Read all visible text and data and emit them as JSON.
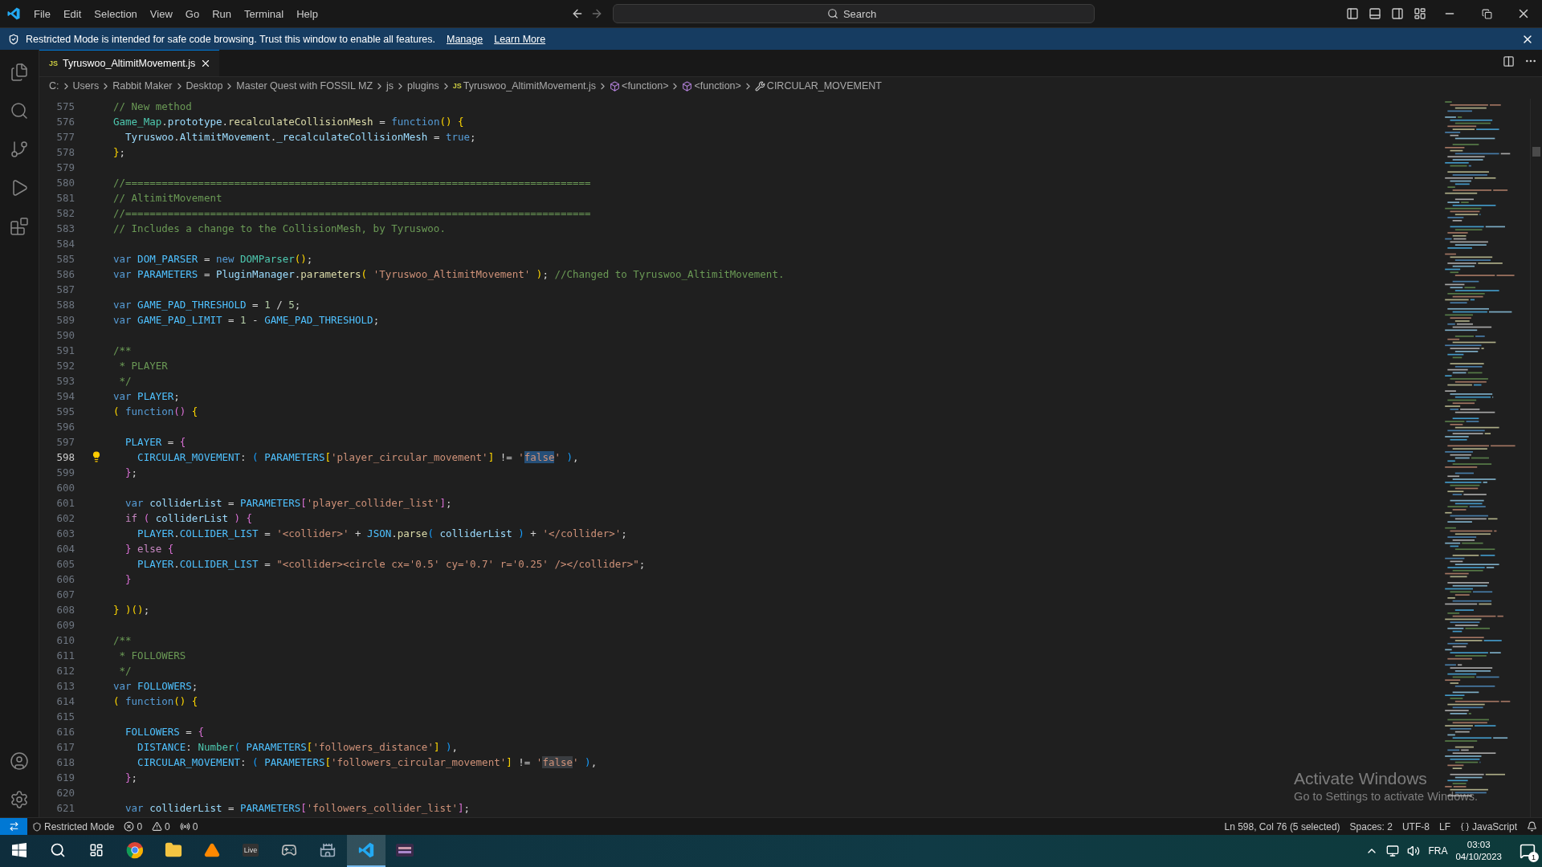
{
  "menu": [
    "File",
    "Edit",
    "Selection",
    "View",
    "Go",
    "Run",
    "Terminal",
    "Help"
  ],
  "search": {
    "placeholder": "Search"
  },
  "banner": {
    "text": "Restricted Mode is intended for safe code browsing. Trust this window to enable all features.",
    "links": [
      "Manage",
      "Learn More"
    ]
  },
  "tabs": [
    {
      "badge": "JS",
      "label": "Tyruswoo_AltimitMovement.js",
      "selected": true
    }
  ],
  "breadcrumb": [
    {
      "kind": "folder",
      "label": "C:"
    },
    {
      "kind": "folder",
      "label": "Users"
    },
    {
      "kind": "folder",
      "label": "Rabbit Maker"
    },
    {
      "kind": "folder",
      "label": "Desktop"
    },
    {
      "kind": "folder",
      "label": "Master Quest with FOSSIL MZ"
    },
    {
      "kind": "folder",
      "label": "js"
    },
    {
      "kind": "folder",
      "label": "plugins"
    },
    {
      "kind": "file",
      "badge": "JS",
      "label": "Tyruswoo_AltimitMovement.js"
    },
    {
      "kind": "function",
      "label": "<function>"
    },
    {
      "kind": "function",
      "label": "<function>"
    },
    {
      "kind": "property",
      "label": "CIRCULAR_MOVEMENT"
    }
  ],
  "lines": [
    {
      "number": "575",
      "current": false,
      "tokens": [
        {
          "kind": "cm",
          "text": "// New method"
        }
      ]
    },
    {
      "number": "576",
      "current": false,
      "tokens": [
        {
          "kind": "ty",
          "text": "Game_Map"
        },
        {
          "kind": "op",
          "text": "."
        },
        {
          "kind": "var",
          "text": "prototype"
        },
        {
          "kind": "op",
          "text": "."
        },
        {
          "kind": "fn",
          "text": "recalculateCollisionMesh"
        },
        {
          "kind": "op",
          "text": " = "
        },
        {
          "kind": "kw",
          "text": "function"
        },
        {
          "kind": "b1",
          "text": "() "
        },
        {
          "kind": "b1",
          "text": "{"
        }
      ]
    },
    {
      "number": "577",
      "current": false,
      "tokens": [
        {
          "kind": "var",
          "text": "  Tyruswoo"
        },
        {
          "kind": "op",
          "text": "."
        },
        {
          "kind": "var",
          "text": "AltimitMovement"
        },
        {
          "kind": "op",
          "text": "."
        },
        {
          "kind": "var",
          "text": "_recalculateCollisionMesh"
        },
        {
          "kind": "op",
          "text": " = "
        },
        {
          "kind": "kw",
          "text": "true"
        },
        {
          "kind": "op",
          "text": ";"
        }
      ]
    },
    {
      "number": "578",
      "current": false,
      "tokens": [
        {
          "kind": "b1",
          "text": "}"
        },
        {
          "kind": "op",
          "text": ";"
        }
      ]
    },
    {
      "number": "579",
      "current": false
    },
    {
      "number": "580",
      "current": false,
      "tokens": [
        {
          "kind": "cm",
          "text": "//============================================================================="
        }
      ]
    },
    {
      "number": "581",
      "current": false,
      "tokens": [
        {
          "kind": "cm",
          "text": "// AltimitMovement"
        }
      ]
    },
    {
      "number": "582",
      "current": false,
      "tokens": [
        {
          "kind": "cm",
          "text": "//============================================================================="
        }
      ]
    },
    {
      "number": "583",
      "current": false,
      "tokens": [
        {
          "kind": "cm",
          "text": "// Includes a change to the CollisionMesh, by Tyruswoo."
        }
      ]
    },
    {
      "number": "584",
      "current": false
    },
    {
      "number": "585",
      "current": false,
      "tokens": [
        {
          "kind": "kw",
          "text": "var "
        },
        {
          "kind": "cst",
          "text": "DOM_PARSER"
        },
        {
          "kind": "op",
          "text": " = "
        },
        {
          "kind": "kw",
          "text": "new "
        },
        {
          "kind": "ty",
          "text": "DOMParser"
        },
        {
          "kind": "b1",
          "text": "()"
        },
        {
          "kind": "op",
          "text": ";"
        }
      ]
    },
    {
      "number": "586",
      "current": false,
      "tokens": [
        {
          "kind": "kw",
          "text": "var "
        },
        {
          "kind": "cst",
          "text": "PARAMETERS"
        },
        {
          "kind": "op",
          "text": " = "
        },
        {
          "kind": "var",
          "text": "PluginManager"
        },
        {
          "kind": "op",
          "text": "."
        },
        {
          "kind": "fn",
          "text": "parameters"
        },
        {
          "kind": "b1",
          "text": "( "
        },
        {
          "kind": "str",
          "text": "'Tyruswoo_AltimitMovement' "
        },
        {
          "kind": "b1",
          "text": ")"
        },
        {
          "kind": "op",
          "text": "; "
        },
        {
          "kind": "cm",
          "text": "//Changed to Tyruswoo_AltimitMovement."
        }
      ]
    },
    {
      "number": "587",
      "current": false
    },
    {
      "number": "588",
      "current": false,
      "tokens": [
        {
          "kind": "kw",
          "text": "var "
        },
        {
          "kind": "cst",
          "text": "GAME_PAD_THRESHOLD"
        },
        {
          "kind": "op",
          "text": " = "
        },
        {
          "kind": "num",
          "text": "1"
        },
        {
          "kind": "op",
          "text": " / "
        },
        {
          "kind": "num",
          "text": "5"
        },
        {
          "kind": "op",
          "text": ";"
        }
      ]
    },
    {
      "number": "589",
      "current": false,
      "tokens": [
        {
          "kind": "kw",
          "text": "var "
        },
        {
          "kind": "cst",
          "text": "GAME_PAD_LIMIT"
        },
        {
          "kind": "op",
          "text": " = "
        },
        {
          "kind": "num",
          "text": "1"
        },
        {
          "kind": "op",
          "text": " - "
        },
        {
          "kind": "cst",
          "text": "GAME_PAD_THRESHOLD"
        },
        {
          "kind": "op",
          "text": ";"
        }
      ]
    },
    {
      "number": "590",
      "current": false
    },
    {
      "number": "591",
      "current": false,
      "tokens": [
        {
          "kind": "cm",
          "text": "/**"
        }
      ]
    },
    {
      "number": "592",
      "current": false,
      "tokens": [
        {
          "kind": "cm",
          "text": " * PLAYER"
        }
      ]
    },
    {
      "number": "593",
      "current": false,
      "tokens": [
        {
          "kind": "cm",
          "text": " */"
        }
      ]
    },
    {
      "number": "594",
      "current": false,
      "tokens": [
        {
          "kind": "kw",
          "text": "var "
        },
        {
          "kind": "cst",
          "text": "PLAYER"
        },
        {
          "kind": "op",
          "text": ";"
        }
      ]
    },
    {
      "number": "595",
      "current": false,
      "tokens": [
        {
          "kind": "b1",
          "text": "( "
        },
        {
          "kind": "kw",
          "text": "function"
        },
        {
          "kind": "b2",
          "text": "() "
        },
        {
          "kind": "b1",
          "text": "{"
        }
      ]
    },
    {
      "number": "596",
      "current": false
    },
    {
      "number": "597",
      "current": false,
      "tokens": [
        {
          "kind": "cst",
          "text": "  PLAYER"
        },
        {
          "kind": "op",
          "text": " = "
        },
        {
          "kind": "b2",
          "text": "{"
        }
      ]
    },
    {
      "number": "598",
      "current": true,
      "tokens": [
        {
          "kind": "cst",
          "text": "    CIRCULAR_MOVEMENT"
        },
        {
          "kind": "op",
          "text": ": "
        },
        {
          "kind": "b3",
          "text": "( "
        },
        {
          "kind": "cst",
          "text": "PARAMETERS"
        },
        {
          "kind": "b1",
          "text": "["
        },
        {
          "kind": "str",
          "text": "'player_circular_movement'"
        },
        {
          "kind": "b1",
          "text": "]"
        },
        {
          "kind": "op",
          "text": " != "
        },
        {
          "kind": "str",
          "text": "'"
        },
        {
          "kind": "sel",
          "text": "false"
        },
        {
          "kind": "str",
          "text": "' "
        },
        {
          "kind": "b3",
          "text": ")"
        },
        {
          "kind": "op",
          "text": ","
        }
      ]
    },
    {
      "number": "599",
      "current": false,
      "tokens": [
        {
          "kind": "b2",
          "text": "  }"
        },
        {
          "kind": "op",
          "text": ";"
        }
      ]
    },
    {
      "number": "600",
      "current": false
    },
    {
      "number": "601",
      "current": false,
      "tokens": [
        {
          "kind": "kw",
          "text": "  var "
        },
        {
          "kind": "var",
          "text": "colliderList"
        },
        {
          "kind": "op",
          "text": " = "
        },
        {
          "kind": "cst",
          "text": "PARAMETERS"
        },
        {
          "kind": "b2",
          "text": "["
        },
        {
          "kind": "str",
          "text": "'player_collider_list'"
        },
        {
          "kind": "b2",
          "text": "]"
        },
        {
          "kind": "op",
          "text": ";"
        }
      ]
    },
    {
      "number": "602",
      "current": false,
      "tokens": [
        {
          "kind": "ctl",
          "text": "  if "
        },
        {
          "kind": "b2",
          "text": "( "
        },
        {
          "kind": "var",
          "text": "colliderList "
        },
        {
          "kind": "b2",
          "text": ") {"
        }
      ]
    },
    {
      "number": "603",
      "current": false,
      "tokens": [
        {
          "kind": "cst",
          "text": "    PLAYER"
        },
        {
          "kind": "op",
          "text": "."
        },
        {
          "kind": "cst",
          "text": "COLLIDER_LIST"
        },
        {
          "kind": "op",
          "text": " = "
        },
        {
          "kind": "str",
          "text": "'<collider>'"
        },
        {
          "kind": "op",
          "text": " + "
        },
        {
          "kind": "cst",
          "text": "JSON"
        },
        {
          "kind": "op",
          "text": "."
        },
        {
          "kind": "fn",
          "text": "parse"
        },
        {
          "kind": "b3",
          "text": "( "
        },
        {
          "kind": "var",
          "text": "colliderList "
        },
        {
          "kind": "b3",
          "text": ")"
        },
        {
          "kind": "op",
          "text": " + "
        },
        {
          "kind": "str",
          "text": "'</collider>'"
        },
        {
          "kind": "op",
          "text": ";"
        }
      ]
    },
    {
      "number": "604",
      "current": false,
      "tokens": [
        {
          "kind": "b2",
          "text": "  } "
        },
        {
          "kind": "ctl",
          "text": "else "
        },
        {
          "kind": "b2",
          "text": "{"
        }
      ]
    },
    {
      "number": "605",
      "current": false,
      "tokens": [
        {
          "kind": "cst",
          "text": "    PLAYER"
        },
        {
          "kind": "op",
          "text": "."
        },
        {
          "kind": "cst",
          "text": "COLLIDER_LIST"
        },
        {
          "kind": "op",
          "text": " = "
        },
        {
          "kind": "str",
          "text": "\"<collider><circle cx='0.5' cy='0.7' r='0.25' /></collider>\""
        },
        {
          "kind": "op",
          "text": ";"
        }
      ]
    },
    {
      "number": "606",
      "current": false,
      "tokens": [
        {
          "kind": "b2",
          "text": "  }"
        }
      ]
    },
    {
      "number": "607",
      "current": false
    },
    {
      "number": "608",
      "current": false,
      "tokens": [
        {
          "kind": "b1",
          "text": "} )()"
        },
        {
          "kind": "op",
          "text": ";"
        }
      ]
    },
    {
      "number": "609",
      "current": false
    },
    {
      "number": "610",
      "current": false,
      "tokens": [
        {
          "kind": "cm",
          "text": "/**"
        }
      ]
    },
    {
      "number": "611",
      "current": false,
      "tokens": [
        {
          "kind": "cm",
          "text": " * FOLLOWERS"
        }
      ]
    },
    {
      "number": "612",
      "current": false,
      "tokens": [
        {
          "kind": "cm",
          "text": " */"
        }
      ]
    },
    {
      "number": "613",
      "current": false,
      "tokens": [
        {
          "kind": "kw",
          "text": "var "
        },
        {
          "kind": "cst",
          "text": "FOLLOWERS"
        },
        {
          "kind": "op",
          "text": ";"
        }
      ]
    },
    {
      "number": "614",
      "current": false,
      "tokens": [
        {
          "kind": "b1",
          "text": "( "
        },
        {
          "kind": "kw",
          "text": "function"
        },
        {
          "kind": "b1",
          "text": "() {"
        }
      ]
    },
    {
      "number": "615",
      "current": false
    },
    {
      "number": "616",
      "current": false,
      "tokens": [
        {
          "kind": "cst",
          "text": "  FOLLOWERS"
        },
        {
          "kind": "op",
          "text": " = "
        },
        {
          "kind": "b2",
          "text": "{"
        }
      ]
    },
    {
      "number": "617",
      "current": false,
      "tokens": [
        {
          "kind": "cst",
          "text": "    DISTANCE"
        },
        {
          "kind": "op",
          "text": ": "
        },
        {
          "kind": "ty",
          "text": "Number"
        },
        {
          "kind": "b3",
          "text": "( "
        },
        {
          "kind": "cst",
          "text": "PARAMETERS"
        },
        {
          "kind": "b1",
          "text": "["
        },
        {
          "kind": "str",
          "text": "'followers_distance'"
        },
        {
          "kind": "b1",
          "text": "] "
        },
        {
          "kind": "b3",
          "text": ")"
        },
        {
          "kind": "op",
          "text": ","
        }
      ]
    },
    {
      "number": "618",
      "current": false,
      "tokens": [
        {
          "kind": "cst",
          "text": "    CIRCULAR_MOVEMENT"
        },
        {
          "kind": "op",
          "text": ": "
        },
        {
          "kind": "b3",
          "text": "( "
        },
        {
          "kind": "cst",
          "text": "PARAMETERS"
        },
        {
          "kind": "b1",
          "text": "["
        },
        {
          "kind": "str",
          "text": "'followers_circular_movement'"
        },
        {
          "kind": "b1",
          "text": "]"
        },
        {
          "kind": "op",
          "text": " != "
        },
        {
          "kind": "str",
          "text": "'"
        },
        {
          "kind": "match",
          "text": "false"
        },
        {
          "kind": "str",
          "text": "' "
        },
        {
          "kind": "b3",
          "text": ")"
        },
        {
          "kind": "op",
          "text": ","
        }
      ]
    },
    {
      "number": "619",
      "current": false,
      "tokens": [
        {
          "kind": "b2",
          "text": "  }"
        },
        {
          "kind": "op",
          "text": ";"
        }
      ]
    },
    {
      "number": "620",
      "current": false
    },
    {
      "number": "621",
      "current": false,
      "tokens": [
        {
          "kind": "kw",
          "text": "  var "
        },
        {
          "kind": "var",
          "text": "colliderList"
        },
        {
          "kind": "op",
          "text": " = "
        },
        {
          "kind": "cst",
          "text": "PARAMETERS"
        },
        {
          "kind": "b2",
          "text": "["
        },
        {
          "kind": "str",
          "text": "'followers_collider_list'"
        },
        {
          "kind": "b2",
          "text": "]"
        },
        {
          "kind": "op",
          "text": ";"
        }
      ]
    }
  ],
  "activation": {
    "title": "Activate Windows",
    "text": "Go to Settings to activate Windows."
  },
  "status_bar": {
    "left": [
      {
        "kind": "restricted",
        "text": "Restricted Mode"
      },
      {
        "kind": "errors",
        "text": "0"
      },
      {
        "kind": "warnings",
        "text": "0"
      },
      {
        "kind": "ports",
        "text": "0"
      }
    ],
    "right": [
      {
        "kind": "plain",
        "text": "Ln 598, Col 76 (5 selected)"
      },
      {
        "kind": "plain",
        "text": "Spaces: 2"
      },
      {
        "kind": "plain",
        "text": "UTF-8"
      },
      {
        "kind": "plain",
        "text": "LF"
      },
      {
        "kind": "language",
        "text": "JavaScript"
      }
    ]
  },
  "taskbar": {
    "apps": [
      {
        "kind": "browser",
        "active": false
      },
      {
        "kind": "folder",
        "active": false
      },
      {
        "kind": "cone",
        "active": false
      },
      {
        "kind": "live",
        "label": "Live",
        "active": false
      },
      {
        "kind": "game",
        "active": false
      },
      {
        "kind": "game2",
        "active": false
      },
      {
        "kind": "editor",
        "active": true
      },
      {
        "kind": "game3",
        "active": false
      }
    ],
    "language": "FRA",
    "time": "03:03",
    "date": "04/10/2023",
    "notifications": "1"
  }
}
